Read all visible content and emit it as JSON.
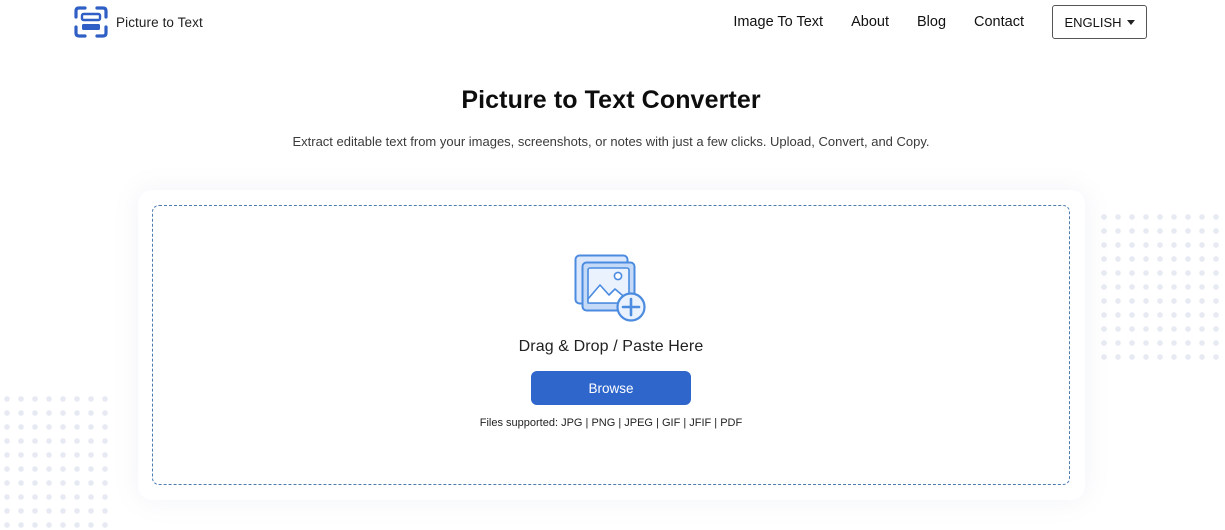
{
  "brand": {
    "name": "Picture to Text",
    "icon": "scan-document-icon",
    "accent_color": "#2f66cc"
  },
  "nav": {
    "links": [
      {
        "label": "Image To Text"
      },
      {
        "label": "About"
      },
      {
        "label": "Blog"
      },
      {
        "label": "Contact"
      }
    ],
    "language": "ENGLISH"
  },
  "hero": {
    "title": "Picture to Text Converter",
    "subtitle": "Extract editable text from your images, screenshots, or notes with just a few clicks. Upload, Convert, and Copy."
  },
  "upload": {
    "icon": "add-image-icon",
    "drop_text": "Drag & Drop / Paste Here",
    "browse_label": "Browse",
    "supported_text": "Files supported: JPG | PNG | JPEG | GIF | JFIF | PDF"
  }
}
